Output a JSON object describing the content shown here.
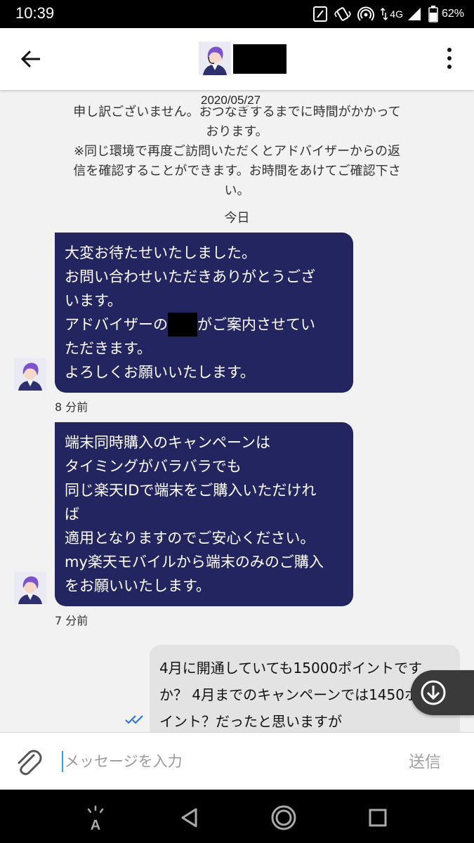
{
  "status_bar": {
    "time": "10:39",
    "network": "4G",
    "battery": "62%",
    "icons": [
      "nfc-icon",
      "vibrate-icon",
      "hotspot-icon",
      "data-arrows-icon",
      "signal-icon",
      "battery-icon"
    ]
  },
  "header": {
    "back_icon": "arrow-left-icon",
    "avatar": "advisor-avatar",
    "menu_icon": "more-vertical-icon"
  },
  "chat": {
    "date": "2020/05/27",
    "system_message": [
      "申し訳ございません。おつなぎするまでに時間がかかって",
      "おります。",
      "※同じ環境で再度ご訪問いただくとアドバイザーからの返",
      "信を確認することができます。お時間をあけてご確認下さ",
      "い。"
    ],
    "day_separator": "今日",
    "messages": [
      {
        "sender": "agent",
        "lines": [
          "大変お待たせいたしました。",
          "お問い合わせいただきありがとうござ",
          "います。"
        ],
        "line4_before": "アドバイザーの",
        "line4_after": "がご案内させてい",
        "lines_end": [
          "ただきます。",
          "よろしくお願いいたします。"
        ],
        "time": "8 分前"
      },
      {
        "sender": "agent",
        "lines": [
          "端末同時購入のキャンペーンは",
          "タイミングがバラバラでも",
          "同じ楽天IDで端末をご購入いただけれ",
          "ば",
          "適用となりますのでご安心ください。",
          "my楽天モバイルから端末のみのご購入",
          "をお願いいたします。"
        ],
        "time": "7 分前"
      },
      {
        "sender": "user",
        "lines": [
          "4月に開通していても15000ポイントです",
          "か？ 4月までのキャンペーンでは1450ポ",
          "イント？だったと思いますが"
        ],
        "status": "read"
      }
    ]
  },
  "composer": {
    "placeholder": "メッセージを入力",
    "send_label": "送信",
    "attach_icon": "paperclip-icon"
  },
  "nav_bar": {
    "icons": [
      "accessibility-icon",
      "back-triangle-icon",
      "home-circle-icon",
      "recents-square-icon"
    ]
  },
  "colors": {
    "agent_bubble": "#232560",
    "user_bubble": "#e3e3e3",
    "accent": "#2aa3d8"
  }
}
